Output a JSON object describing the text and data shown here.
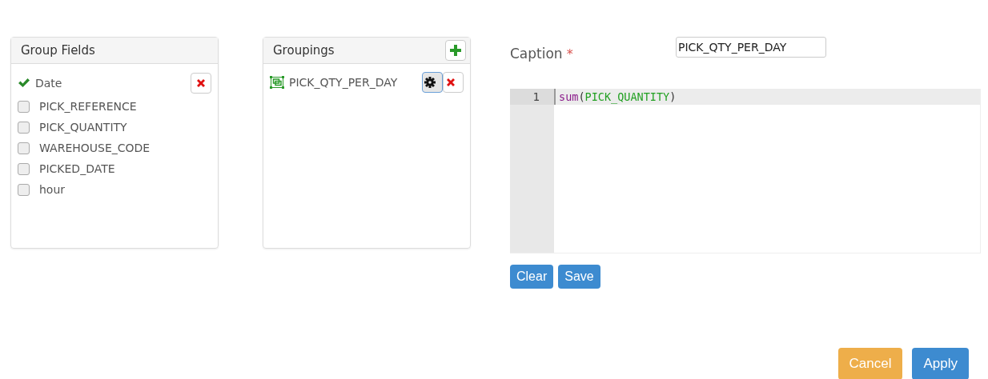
{
  "group_fields": {
    "title": "Group Fields",
    "items": [
      {
        "label": "Date",
        "checked": true
      },
      {
        "label": "PICK_REFERENCE",
        "checked": false
      },
      {
        "label": "PICK_QUANTITY",
        "checked": false
      },
      {
        "label": "WAREHOUSE_CODE",
        "checked": false
      },
      {
        "label": "PICKED_DATE",
        "checked": false
      },
      {
        "label": "hour",
        "checked": false
      }
    ]
  },
  "groupings": {
    "title": "Groupings",
    "items": [
      {
        "label": "PICK_QTY_PER_DAY",
        "selected": true
      }
    ]
  },
  "caption": {
    "label": "Caption",
    "required_mark": "*",
    "value": "PICK_QTY_PER_DAY"
  },
  "editor": {
    "lines": [
      {
        "number": "1",
        "tokens": [
          {
            "kind": "function",
            "text": "sum"
          },
          {
            "kind": "punct",
            "text": "("
          },
          {
            "kind": "field",
            "text": "PICK_QUANTITY"
          },
          {
            "kind": "punct",
            "text": ")"
          }
        ]
      }
    ]
  },
  "editor_buttons": [
    "Clear",
    "Save"
  ],
  "footer_buttons": [
    {
      "label": "Cancel",
      "kind": "warning"
    },
    {
      "label": "Apply",
      "kind": "primary"
    }
  ]
}
